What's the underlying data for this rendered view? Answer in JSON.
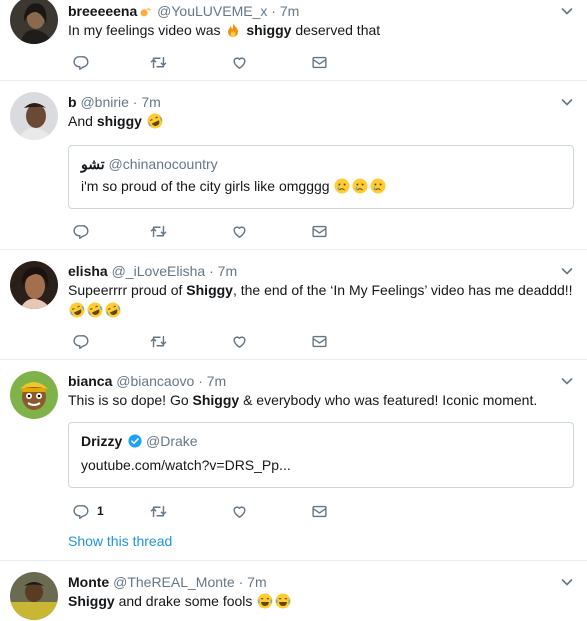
{
  "tweets": [
    {
      "name": "breeeeena",
      "handle": "@YouLUVEME_x",
      "time": "7m",
      "text_before": "In my feelings video was",
      "text_highlight": "shiggy",
      "text_after": "deserved that"
    },
    {
      "name": "b",
      "handle": "@bnirie",
      "time": "7m",
      "text_before": "And",
      "text_highlight": "shiggy",
      "quote": {
        "name": "تشو",
        "handle": "@chinanocountry",
        "text": "i'm so proud of the city girls like omgggg"
      }
    },
    {
      "name": "elisha",
      "handle": "@_iLoveElisha",
      "time": "7m",
      "text_before": "Supeerrrr proud of",
      "text_highlight": "Shiggy",
      "text_after": ", the end of the ‘In My Feelings’ video has me deaddd!!"
    },
    {
      "name": "bianca",
      "handle": "@biancaovo",
      "time": "7m",
      "text_before": "This is so dope! Go",
      "text_highlight": "Shiggy",
      "text_after": "& everybody who was featured! Iconic moment.",
      "reply_count": "1",
      "show_thread": "Show this thread",
      "quote": {
        "name": "Drizzy",
        "handle": "@Drake",
        "text": "youtube.com/watch?v=DRS_Pp..."
      }
    },
    {
      "name": "Monte",
      "handle": "@TheREAL_Monte",
      "time": "7m",
      "text_highlight": "Shiggy",
      "text_after": "and drake some fools"
    }
  ],
  "sep": "·",
  "icons": [
    "reply-icon",
    "retweet-icon",
    "like-icon",
    "dm-icon",
    "caret-down-icon",
    "verified-icon"
  ],
  "colors": {
    "link": "#1b95e0",
    "muted": "#657786",
    "icon": "#657786",
    "border": "#e6ecf0"
  }
}
